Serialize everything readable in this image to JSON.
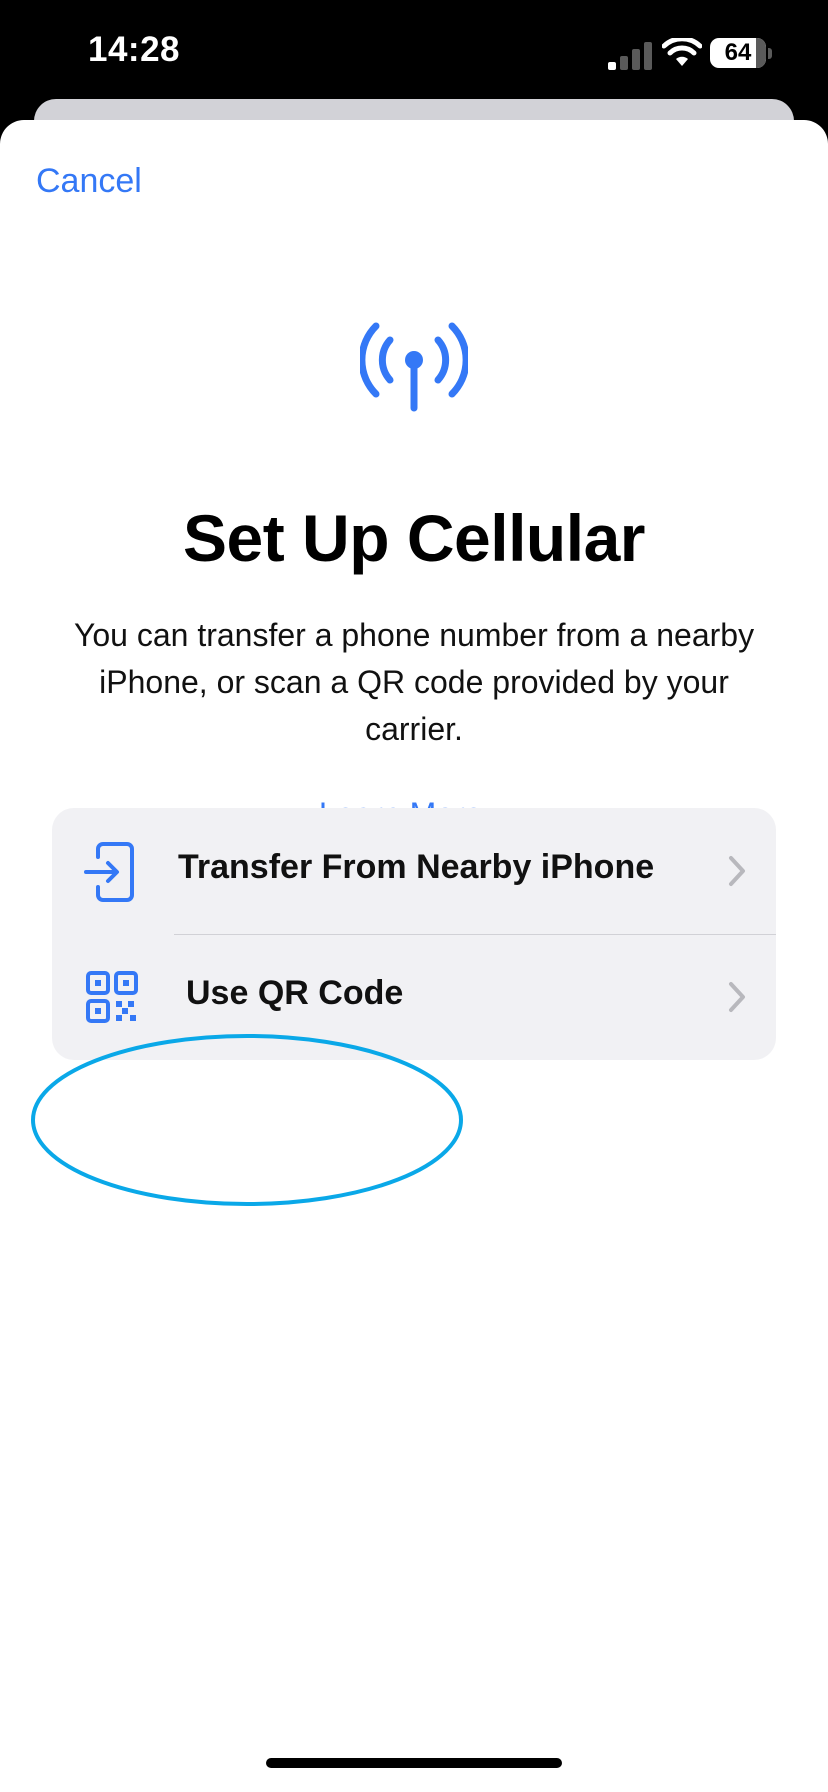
{
  "status_bar": {
    "time": "14:28",
    "battery_level": "64"
  },
  "sheet": {
    "cancel_label": "Cancel",
    "title": "Set Up Cellular",
    "description": "You can transfer a phone number from a nearby iPhone, or scan a QR code provided by your carrier.",
    "learn_more_label": "Learn More..."
  },
  "options": [
    {
      "label": "Transfer From Nearby iPhone",
      "icon": "phone-transfer-icon"
    },
    {
      "label": "Use QR Code",
      "icon": "qr-code-icon"
    }
  ],
  "colors": {
    "accent": "#3478f6",
    "highlight_annotation": "#0aa8e8",
    "group_background": "#f1f1f4"
  }
}
